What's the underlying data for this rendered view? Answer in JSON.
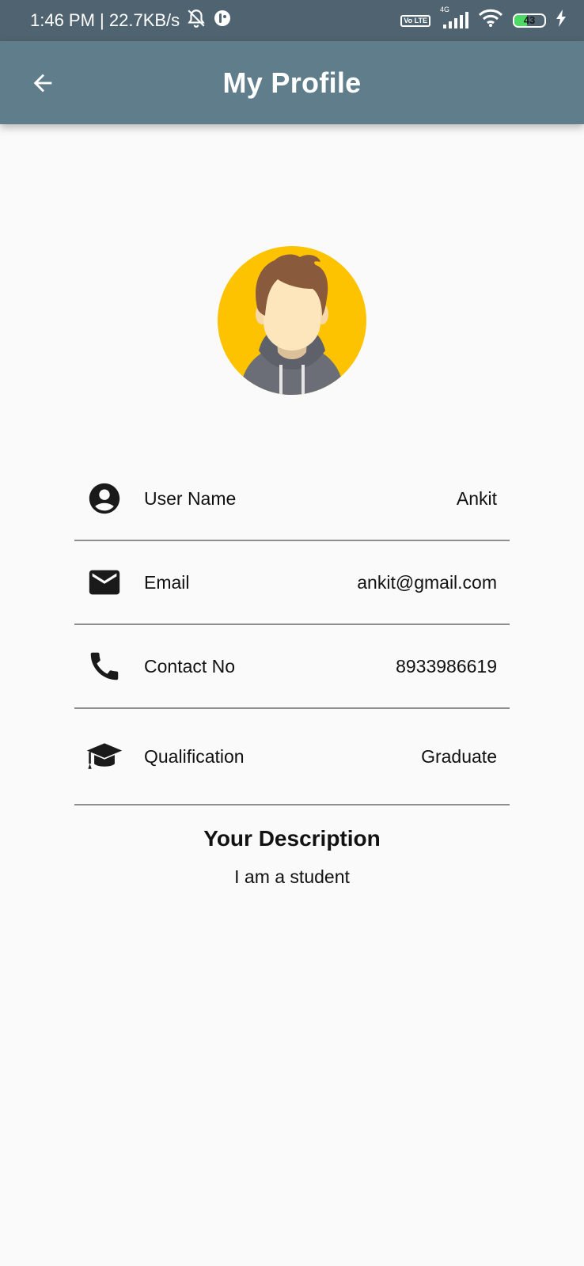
{
  "status_bar": {
    "time_speed": "1:46 PM | 22.7KB/s",
    "network_type": "4G",
    "volte_badge": "Vo LTE",
    "battery_level": "43",
    "battery_fraction": 0.43,
    "battery_fill_color": "#4cd964",
    "icons": [
      "alarm-off-icon",
      "app-notification-icon",
      "volte-icon",
      "signal-icon",
      "wifi-icon",
      "battery-icon",
      "charging-icon"
    ]
  },
  "app_bar": {
    "title": "My Profile",
    "back_icon": "arrow-back-icon",
    "background": "#607d8b"
  },
  "profile": {
    "avatar_icon": "profile-avatar",
    "avatar_background": "#fdc300",
    "rows": [
      {
        "icon": "account-circle-icon",
        "label": "User Name",
        "value": "Ankit"
      },
      {
        "icon": "email-icon",
        "label": "Email",
        "value": "ankit@gmail.com"
      },
      {
        "icon": "phone-icon",
        "label": "Contact No",
        "value": "8933986619"
      },
      {
        "icon": "graduation-cap-icon",
        "label": "Qualification",
        "value": "Graduate"
      }
    ]
  },
  "description": {
    "title": "Your Description",
    "text": "I am a student"
  }
}
